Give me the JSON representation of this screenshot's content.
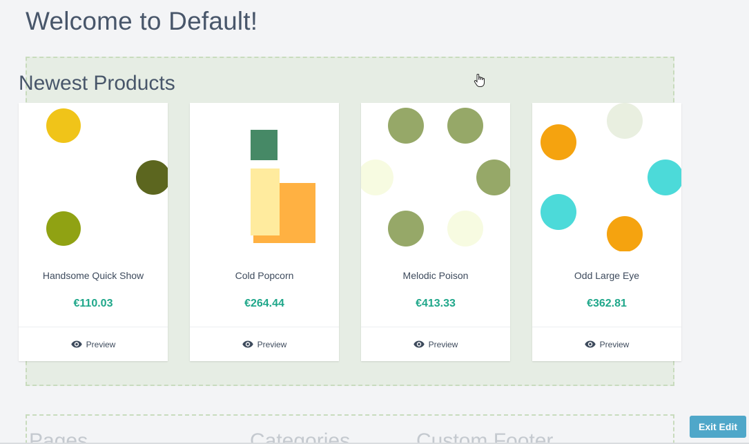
{
  "page": {
    "title": "Welcome to Default!"
  },
  "section": {
    "title": "Newest Products"
  },
  "products": [
    {
      "name": "Handsome Quick Show",
      "price": "€110.03",
      "preview_label": "Preview"
    },
    {
      "name": "Cold Popcorn",
      "price": "€264.44",
      "preview_label": "Preview"
    },
    {
      "name": "Melodic Poison",
      "price": "€413.33",
      "preview_label": "Preview"
    },
    {
      "name": "Odd Large Eye",
      "price": "€362.81",
      "preview_label": "Preview"
    }
  ],
  "footer": {
    "headings": [
      "Pages",
      "Categories",
      "Custom Footer"
    ]
  },
  "toolbar": {
    "exit_edit_label": "Exit Edit"
  },
  "colors": {
    "accent_price": "#1fa78a",
    "exit_button": "#4fa7c9",
    "edit_zone_bg": "#e6ede4"
  }
}
